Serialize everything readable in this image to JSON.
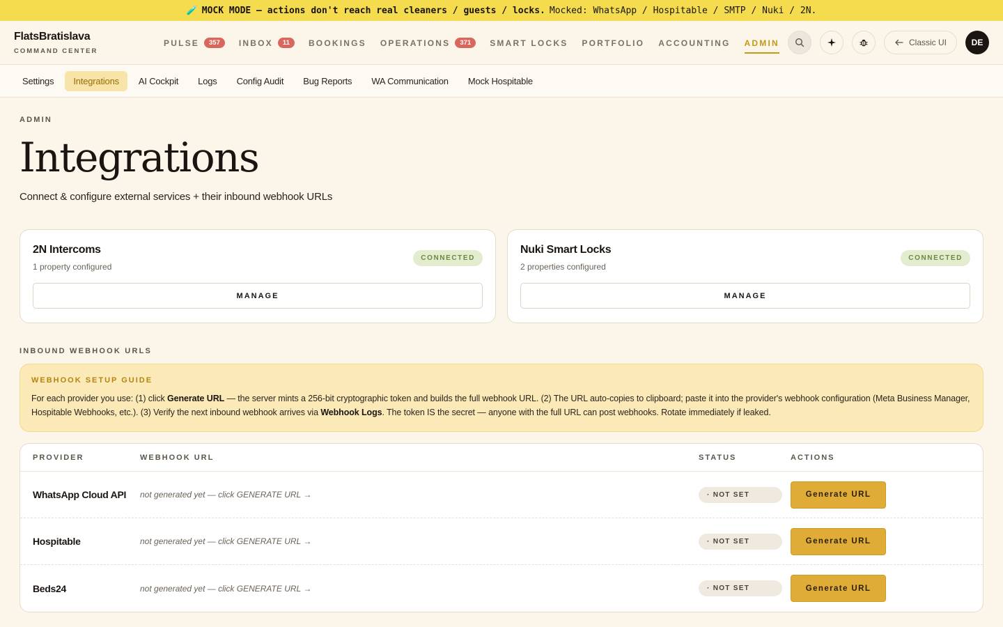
{
  "banner": {
    "icon": "🧪",
    "strong_text": "MOCK MODE — actions don't reach real cleaners / guests / locks.",
    "details": "Mocked: WhatsApp / Hospitable / SMTP / Nuki / 2N."
  },
  "brand": {
    "name": "FlatsBratislava",
    "subtitle": "COMMAND CENTER"
  },
  "nav": [
    {
      "label": "PULSE",
      "badge": "357",
      "active": false
    },
    {
      "label": "INBOX",
      "badge": "11",
      "active": false
    },
    {
      "label": "BOOKINGS",
      "badge": null,
      "active": false
    },
    {
      "label": "OPERATIONS",
      "badge": "371",
      "active": false
    },
    {
      "label": "SMART LOCKS",
      "badge": null,
      "active": false
    },
    {
      "label": "PORTFOLIO",
      "badge": null,
      "active": false
    },
    {
      "label": "ACCOUNTING",
      "badge": null,
      "active": false
    },
    {
      "label": "ADMIN",
      "badge": null,
      "active": true
    }
  ],
  "header_actions": {
    "search_icon": "search-icon",
    "sparkle_icon": "sparkle-icon",
    "bug_icon": "bug-icon",
    "classic_label": "Classic UI",
    "avatar_initials": "DE"
  },
  "subnav": [
    {
      "label": "Settings",
      "active": false
    },
    {
      "label": "Integrations",
      "active": true
    },
    {
      "label": "AI Cockpit",
      "active": false
    },
    {
      "label": "Logs",
      "active": false
    },
    {
      "label": "Config Audit",
      "active": false
    },
    {
      "label": "Bug Reports",
      "active": false
    },
    {
      "label": "WA Communication",
      "active": false
    },
    {
      "label": "Mock Hospitable",
      "active": false
    }
  ],
  "page": {
    "eyebrow": "ADMIN",
    "title": "Integrations",
    "subtitle": "Connect & configure external services + their inbound webhook URLs"
  },
  "cards": [
    {
      "title": "2N Intercoms",
      "meta": "1 property configured",
      "status": "CONNECTED",
      "button": "MANAGE"
    },
    {
      "title": "Nuki Smart Locks",
      "meta": "2 properties configured",
      "status": "CONNECTED",
      "button": "MANAGE"
    }
  ],
  "webhooks": {
    "section_label": "INBOUND WEBHOOK URLS",
    "guide": {
      "title": "WEBHOOK SETUP GUIDE",
      "p1": "For each provider you use: (1) click ",
      "b1": "Generate URL",
      "p2": " — the server mints a 256-bit cryptographic token and builds the full webhook URL. (2) The URL auto-copies to clipboard; paste it into the provider's webhook configuration (Meta Business Manager, Hospitable Webhooks, etc.). (3) Verify the next inbound webhook arrives via ",
      "b2": "Webhook Logs",
      "p3": ". The token IS the secret — anyone with the full URL can post webhooks. Rotate immediately if leaked."
    },
    "columns": {
      "provider": "PROVIDER",
      "url": "WEBHOOK URL",
      "status": "STATUS",
      "actions": "ACTIONS"
    },
    "rows": [
      {
        "provider": "WhatsApp Cloud API",
        "url": "not generated yet — click GENERATE URL →",
        "status": "· NOT SET",
        "action": "Generate URL"
      },
      {
        "provider": "Hospitable",
        "url": "not generated yet — click GENERATE URL →",
        "status": "· NOT SET",
        "action": "Generate URL"
      },
      {
        "provider": "Beds24",
        "url": "not generated yet — click GENERATE URL →",
        "status": "· NOT SET",
        "action": "Generate URL"
      }
    ]
  },
  "colors": {
    "banner_bg": "#f5dc4e",
    "accent": "#c49a13",
    "badge": "#d9675d",
    "connected_bg": "#e4ecd0",
    "generate_btn": "#dfac38"
  }
}
